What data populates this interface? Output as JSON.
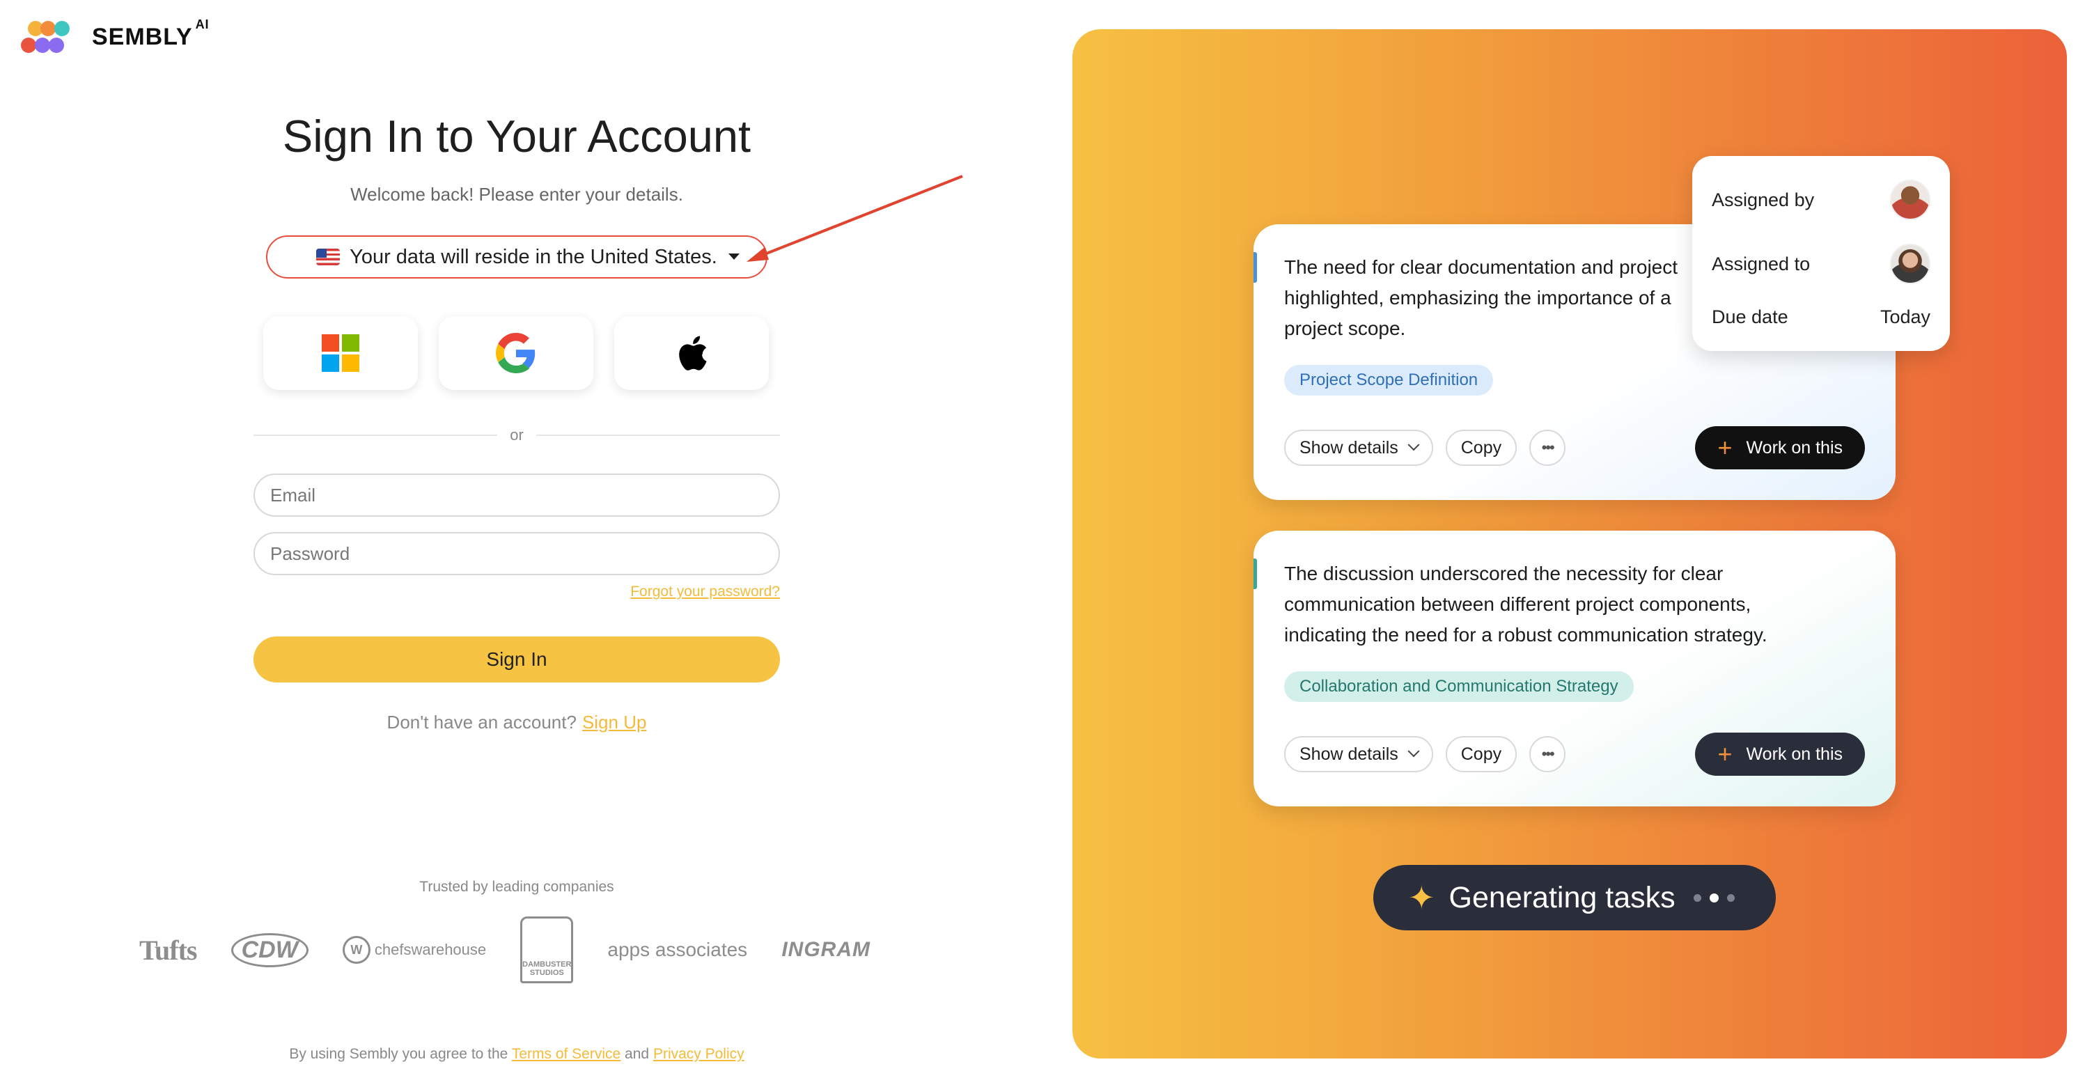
{
  "brand": {
    "name": "SEMBLY",
    "superscript": "AI",
    "colors": [
      "#f5b33c",
      "#3ec7c0",
      "#e9543f",
      "#f28b3a",
      "#8b6bf0"
    ]
  },
  "signin": {
    "title": "Sign In to Your Account",
    "subtitle": "Welcome back! Please enter your details.",
    "region_text": "Your data will reside in the United States.",
    "region_icon": "us-flag-icon",
    "social": [
      {
        "name": "microsoft",
        "icon": "microsoft-logo-icon"
      },
      {
        "name": "google",
        "icon": "google-logo-icon"
      },
      {
        "name": "apple",
        "icon": "apple-logo-icon"
      }
    ],
    "divider_text": "or",
    "email_placeholder": "Email",
    "password_placeholder": "Password",
    "forgot_label": "Forgot your password?",
    "signin_label": "Sign In",
    "no_account_text": "Don't have an account?",
    "signup_label": "Sign Up"
  },
  "trusted": {
    "label": "Trusted by leading companies",
    "companies": [
      "Tufts",
      "CDW",
      "chefswarehouse",
      "DAMBUSTER STUDIOS",
      "apps associates",
      "INGRAM"
    ]
  },
  "terms": {
    "prefix": "By using Sembly you agree to the",
    "tos": "Terms of Service",
    "and": "and",
    "privacy": "Privacy Policy"
  },
  "hero": {
    "assign": {
      "assigned_by": "Assigned by",
      "assigned_to": "Assigned to",
      "due_label": "Due date",
      "due_value": "Today"
    },
    "cards": [
      {
        "text": "The need for clear documentation and project highlighted, emphasizing the importance of a project scope.",
        "tag": "Project Scope Definition",
        "show_details": "Show details",
        "copy": "Copy",
        "work": "Work on this"
      },
      {
        "text": "The discussion underscored the necessity for clear communication between different project components, indicating the need for a robust communication strategy.",
        "tag": "Collaboration and Communication Strategy",
        "show_details": "Show details",
        "copy": "Copy",
        "work": "Work on this"
      }
    ],
    "generating": "Generating tasks"
  }
}
